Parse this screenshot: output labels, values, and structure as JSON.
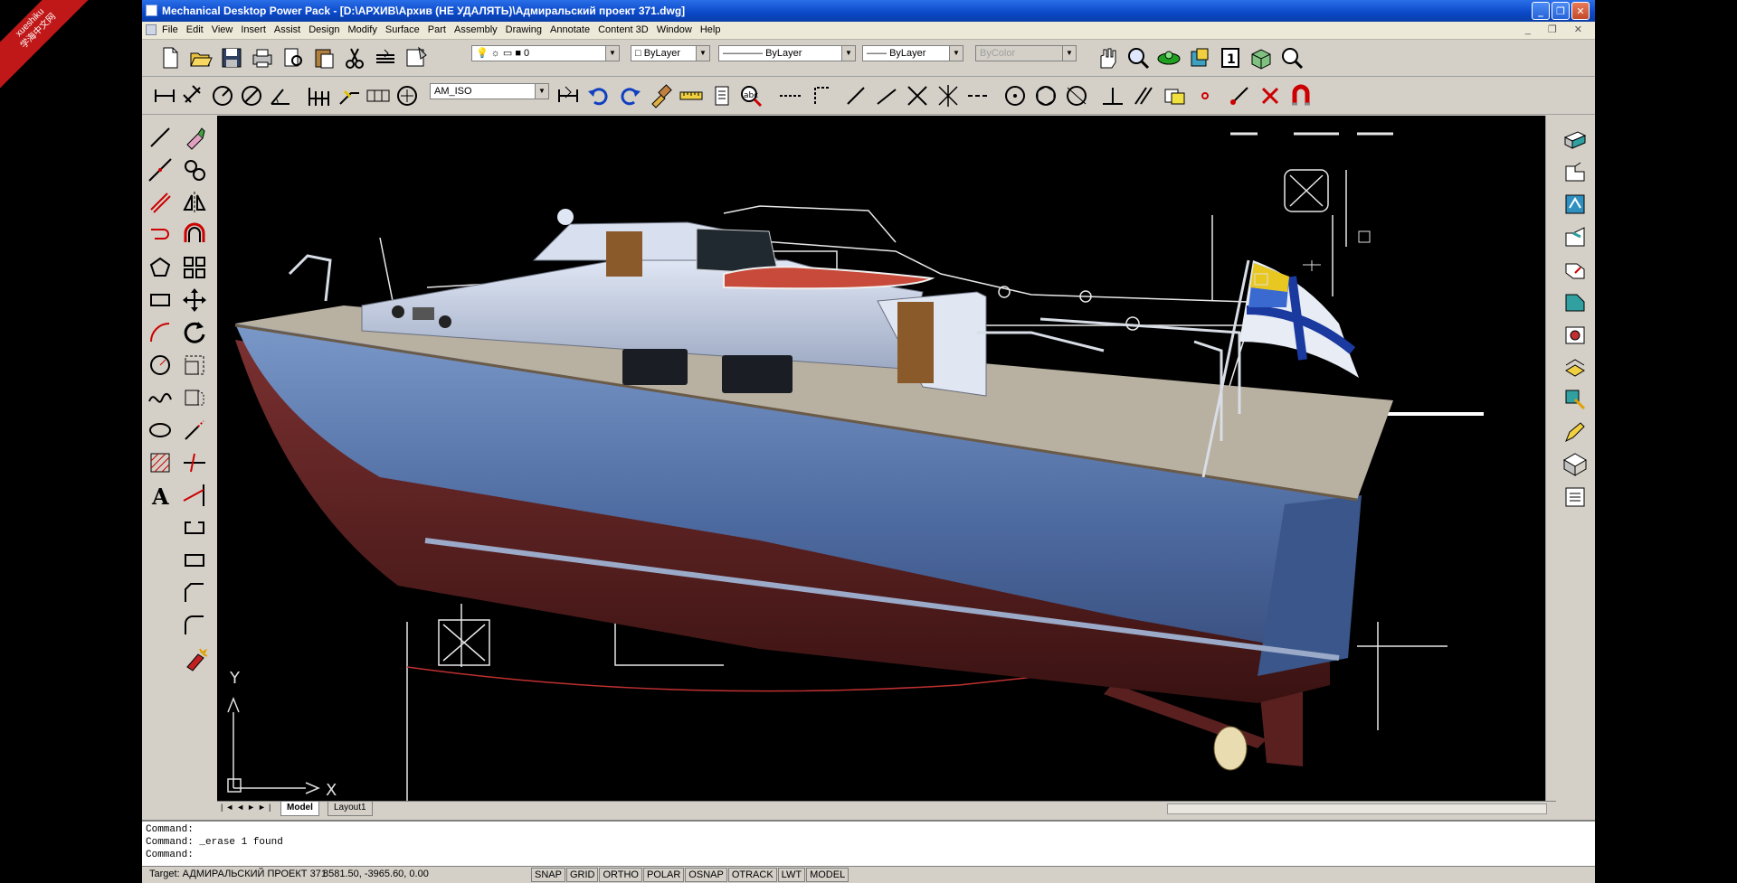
{
  "watermark": {
    "site": "xueshiku",
    "text": "学海中文网"
  },
  "window": {
    "title": "Mechanical Desktop Power Pack - [D:\\АРХИВ\\Архив (НЕ УДАЛЯТЬ)\\Адмиральский проект 371.dwg]"
  },
  "menu": [
    "File",
    "Edit",
    "View",
    "Insert",
    "Assist",
    "Design",
    "Modify",
    "Surface",
    "Part",
    "Assembly",
    "Drawing",
    "Annotate",
    "Content 3D",
    "Window",
    "Help"
  ],
  "properties": {
    "layer": "0",
    "color": "ByLayer",
    "linetype": "ByLayer",
    "lineweight": "ByLayer",
    "plotstyle": "ByColor"
  },
  "dimstyle": "AM_ISO",
  "tabs": {
    "model": "Model",
    "layout1": "Layout1"
  },
  "command": {
    "line1": "Command:",
    "line2": "Command: _erase 1 found",
    "line3": "Command:"
  },
  "status": {
    "target": "Target: АДМИРАЛЬСКИЙ ПРОЕКТ 371",
    "coords": "8581.50, -3965.60, 0.00",
    "toggles": [
      "SNAP",
      "GRID",
      "ORTHO",
      "POLAR",
      "OSNAP",
      "OTRACK",
      "LWT",
      "MODEL"
    ]
  },
  "ucs": {
    "x": "X",
    "y": "Y"
  },
  "colors": {
    "titlebar": "#0a48c8",
    "chrome": "#d4d0c8",
    "hull": "#5d7bb0",
    "bottom_paint": "#6b2a2a",
    "flag_cross": "#1a3aa0",
    "flag_field": "#e8ecf4"
  }
}
